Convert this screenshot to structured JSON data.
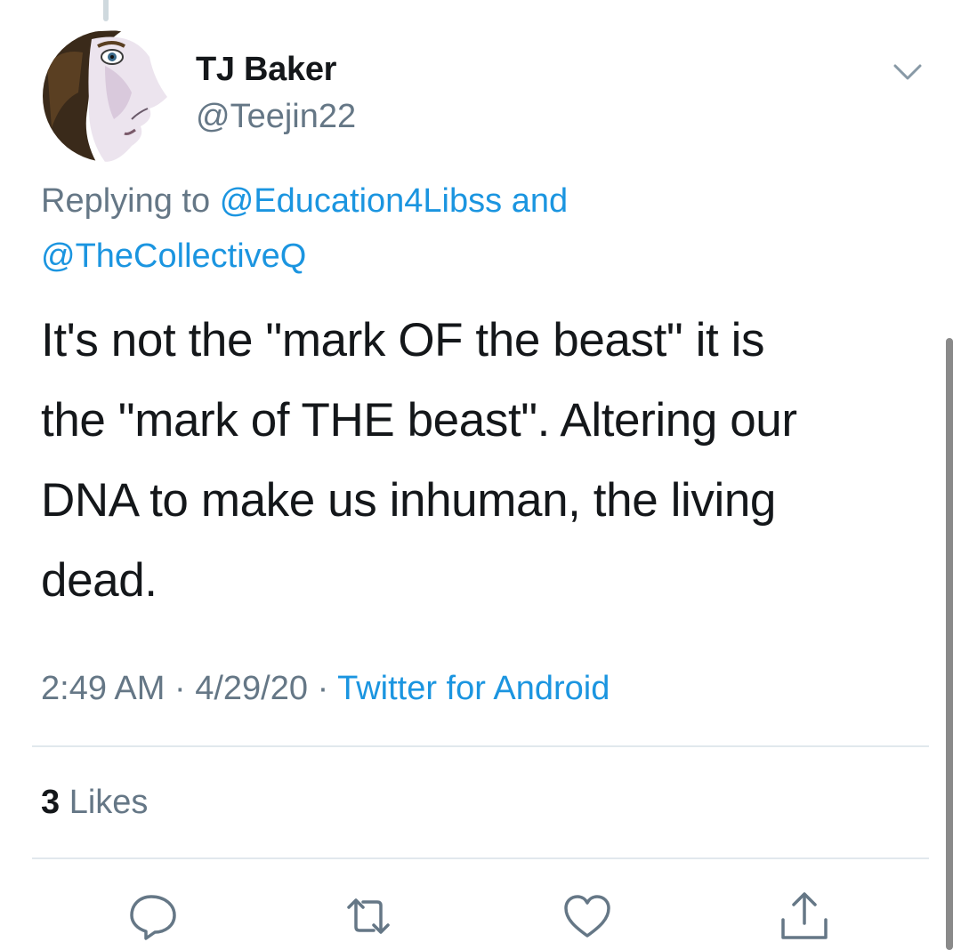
{
  "tweet": {
    "author": {
      "name": "TJ Baker",
      "handle": "@Teejin22"
    },
    "reply": {
      "prefix": "Replying to",
      "mention1": "@Education4Libss",
      "joiner": "and",
      "mention2": "@TheCollectiveQ"
    },
    "text_lines": [
      "It's not the \"mark OF the beast\" it is",
      "the \"mark of THE beast\". Altering our",
      "DNA to make us inhuman, the living",
      "dead."
    ],
    "meta": {
      "time": "2:49 AM",
      "separator": "·",
      "date": "4/29/20",
      "source": "Twitter for Android"
    },
    "likes": {
      "count": "3",
      "label": "Likes"
    }
  },
  "icons": {
    "menu": "chevron-down-icon",
    "reply": "reply-icon",
    "retweet": "retweet-icon",
    "like": "heart-icon",
    "share": "share-icon"
  },
  "colors": {
    "text": "#14171a",
    "secondary": "#657786",
    "link": "#1b95e0",
    "divider": "#e1e8ed"
  }
}
